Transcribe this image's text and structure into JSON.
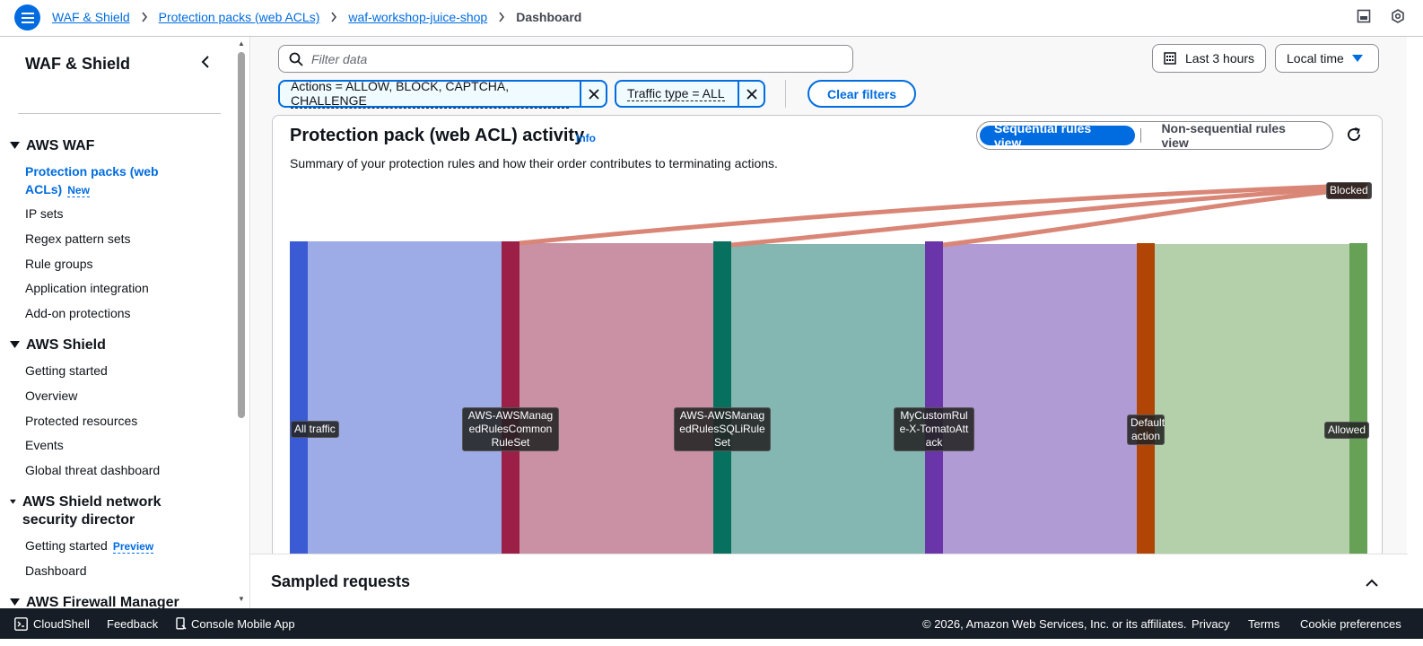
{
  "breadcrumb": {
    "items": [
      "WAF & Shield",
      "Protection packs (web ACLs)",
      "waf-workshop-juice-shop"
    ],
    "current": "Dashboard"
  },
  "sidebar": {
    "title": "WAF & Shield",
    "sections": [
      {
        "label": "AWS WAF"
      },
      {
        "label": "AWS Shield"
      },
      {
        "label": "AWS Shield network security director"
      },
      {
        "label": "AWS Firewall Manager"
      }
    ],
    "items": {
      "protection_packs": "Protection packs (web ACLs)",
      "new_badge": "New",
      "ip_sets": "IP sets",
      "regex_pattern_sets": "Regex pattern sets",
      "rule_groups": "Rule groups",
      "application_integration": "Application integration",
      "addon_protections": "Add-on protections",
      "getting_started": "Getting started",
      "overview": "Overview",
      "protected_resources": "Protected resources",
      "events": "Events",
      "global_threat_dashboard": "Global threat dashboard",
      "nsd_getting_started": "Getting started",
      "preview_badge": "Preview",
      "nsd_dashboard": "Dashboard"
    }
  },
  "filters": {
    "search_placeholder": "Filter data",
    "time_range": "Last 3 hours",
    "timezone": "Local time",
    "tokens": [
      "Actions = ALLOW, BLOCK, CAPTCHA, CHALLENGE",
      "Traffic type = ALL"
    ],
    "clear_label": "Clear filters"
  },
  "panel": {
    "title": "Protection pack (web ACL) activity",
    "info": "Info",
    "description": "Summary of your protection rules and how their order contributes to terminating actions.",
    "view_toggle": {
      "selected": "Sequential rules view",
      "other": "Non-sequential rules view"
    }
  },
  "sankey_nodes": [
    {
      "label": "All traffic",
      "color": "#3a5bd3"
    },
    {
      "label": "AWS-AWSManagedRulesCommonRuleSet",
      "color": "#9b1f47"
    },
    {
      "label": "AWS-AWSManagedRulesSQLiRuleSet",
      "color": "#08705f"
    },
    {
      "label": "MyCustomRule-X-TomatoAttack",
      "color": "#6a35a8"
    },
    {
      "label": "Default action",
      "color": "#b04505"
    },
    {
      "label": "Allowed",
      "color": "#66a155"
    },
    {
      "label": "Blocked",
      "color": "#c54b36"
    }
  ],
  "sampled": {
    "title": "Sampled requests"
  },
  "footer": {
    "cloudshell": "CloudShell",
    "feedback": "Feedback",
    "mobile_app": "Console Mobile App",
    "copyright": "© 2026, Amazon Web Services, Inc. or its affiliates.",
    "privacy": "Privacy",
    "terms": "Terms",
    "cookies": "Cookie preferences"
  }
}
